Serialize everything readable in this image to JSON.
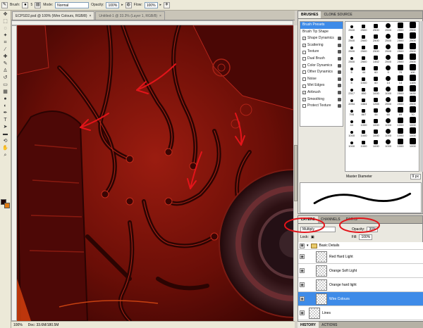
{
  "options_bar": {
    "brush_label": "Brush:",
    "brush_size": "5",
    "mode_label": "Mode:",
    "mode_value": "Normal",
    "opacity_label": "Opacity:",
    "opacity_value": "100%",
    "flow_label": "Flow:",
    "flow_value": "100%"
  },
  "documents": {
    "active_title": "ECPSD2.psd @ 100% (Wire Colours, RGB/8)",
    "inactive_title": "Untitled-1 @ 33.3% (Layer 1, RGB/8)"
  },
  "status_bar": {
    "zoom": "100%",
    "doc": "Doc: 33.6M/180.5M"
  },
  "brushes_panel": {
    "tabs": [
      "BRUSHES",
      "CLONE SOURCE"
    ],
    "categories": [
      {
        "label": "Brush Presets",
        "checked": null
      },
      {
        "label": "Brush Tip Shape",
        "checked": null
      },
      {
        "label": "Shape Dynamics",
        "checked": true
      },
      {
        "label": "Scattering",
        "checked": true
      },
      {
        "label": "Texture",
        "checked": false
      },
      {
        "label": "Dual Brush",
        "checked": false
      },
      {
        "label": "Color Dynamics",
        "checked": false
      },
      {
        "label": "Other Dynamics",
        "checked": false
      },
      {
        "label": "Noise",
        "checked": false
      },
      {
        "label": "Wet Edges",
        "checked": false
      },
      {
        "label": "Airbrush",
        "checked": true
      },
      {
        "label": "Smoothing",
        "checked": true
      },
      {
        "label": "Protect Texture",
        "checked": false
      }
    ],
    "presets": [
      "2500",
      "2500",
      "2500",
      "2500",
      "2500",
      "2500",
      "2500",
      "2500",
      "2500",
      "2500",
      "2500",
      "2500",
      "2500",
      "2500",
      "2500",
      "2500",
      "2500",
      "2500",
      "2500",
      "2500",
      "1452",
      "2500",
      "2500",
      "2500",
      "5",
      "44",
      "60",
      "9",
      "70",
      "100",
      "5",
      "1000",
      "60",
      "14",
      "14",
      "1105",
      "2317",
      "850",
      "1000",
      "1000",
      "2500",
      "1630",
      "2094",
      "1864",
      "1265",
      "2500",
      "2500",
      "2500",
      "795",
      "887",
      "44",
      "60",
      "69",
      "70",
      "44",
      "1000",
      "1000",
      "1000",
      "1000",
      "1000",
      "1000",
      "1000",
      "1000",
      "1000",
      "1000",
      "1000",
      "1000",
      "1000",
      "1000",
      "1000",
      "1000",
      "1000"
    ],
    "master_diameter_label": "Master Diameter",
    "master_diameter_value": "9 px"
  },
  "layers_panel": {
    "tabs": [
      "LAYERS",
      "CHANNELS",
      "PATHS"
    ],
    "blend_mode": "Multiply",
    "opacity_label": "Opacity:",
    "opacity_value": "30%",
    "lock_label": "Lock:",
    "fill_label": "Fill:",
    "fill_value": "100%",
    "layers": [
      {
        "name": "Basic Details",
        "type": "group",
        "selected": false
      },
      {
        "name": "Red Hard Light",
        "type": "layer",
        "selected": false
      },
      {
        "name": "Orange Soft Light",
        "type": "layer",
        "selected": false
      },
      {
        "name": "Orange hard light",
        "type": "layer",
        "selected": false
      },
      {
        "name": "Wire Colours",
        "type": "layer",
        "selected": true
      },
      {
        "name": "Lines",
        "type": "layer",
        "selected": false
      }
    ]
  },
  "bottom_tabs": [
    "HISTORY",
    "ACTIONS"
  ],
  "colors": {
    "canvas_base": "#5c0a05",
    "annotation_red": "#e3141a",
    "selection_blue": "#3e8be8"
  },
  "icons": {
    "tools": [
      "move-icon",
      "marquee-icon",
      "lasso-icon",
      "quick-select-icon",
      "crop-icon",
      "eyedropper-icon",
      "healing-icon",
      "brush-icon",
      "clone-stamp-icon",
      "history-brush-icon",
      "eraser-icon",
      "gradient-icon",
      "blur-icon",
      "dodge-icon",
      "pen-icon",
      "type-icon",
      "path-select-icon",
      "shape-icon",
      "3d-icon",
      "hand-icon",
      "zoom-icon"
    ]
  }
}
